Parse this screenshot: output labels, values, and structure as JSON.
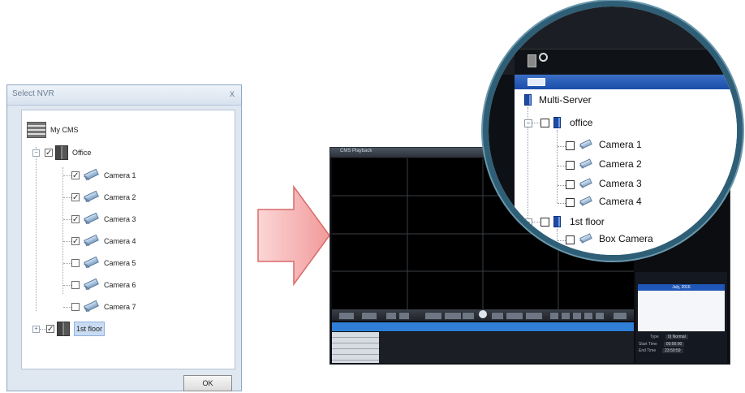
{
  "dialog": {
    "title": "Select NVR",
    "close_glyph": "x",
    "root": {
      "label": "My CMS",
      "icon": "cms-server-icon"
    },
    "office": {
      "label": "Office",
      "expander": "−",
      "checked": true,
      "icon": "nvr-icon"
    },
    "cameras": [
      {
        "label": "Camera 1",
        "checked": true
      },
      {
        "label": "Camera 2",
        "checked": true
      },
      {
        "label": "Camera 3",
        "checked": true
      },
      {
        "label": "Camera 4",
        "checked": true
      },
      {
        "label": "Camera 5",
        "checked": false
      },
      {
        "label": "Camera 6",
        "checked": false
      },
      {
        "label": "Camera 7",
        "checked": false
      }
    ],
    "floor": {
      "label": "1st floor",
      "expander": "+",
      "checked": true,
      "selected": true
    },
    "ok_label": "OK"
  },
  "playback": {
    "title": "CMS Playback",
    "calendar_header": "July, 2016",
    "type_label": "Type",
    "type_value": "0) Normal",
    "start_label": "Start Time",
    "start_value": "00:00:00",
    "end_label": "End Time",
    "end_value": "23:59:59"
  },
  "zoom": {
    "root": "Multi-Server",
    "office": "office",
    "cameras": [
      "Camera 1",
      "Camera 2",
      "Camera 3",
      "Camera 4"
    ],
    "floor": "1st floor",
    "floor_camera": "Box Camera"
  },
  "colors": {
    "arrow": "#f2a5a5",
    "arrow_border": "#d96a6a",
    "magnifier_ring": "#2e5f76",
    "tree_blue": "#1f57b8"
  }
}
